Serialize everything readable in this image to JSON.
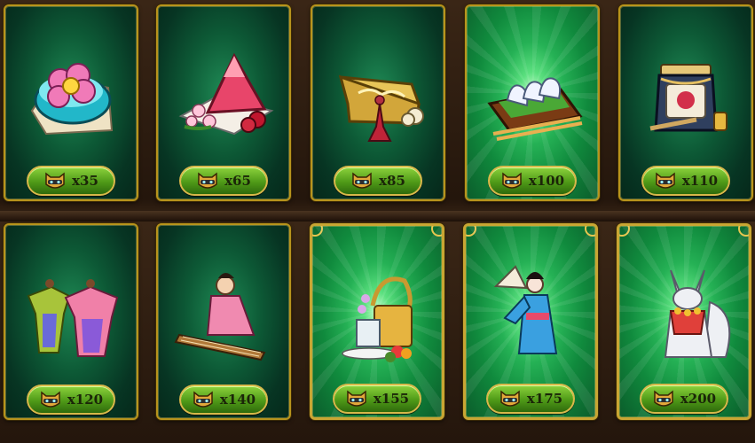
{
  "shop": {
    "currency_icon": "cat-mask-coin-icon",
    "items": [
      {
        "name": "Mochi Bowl",
        "icon": "flower-mochi-bowl-icon",
        "price": "x35"
      },
      {
        "name": "Sakura Cake",
        "icon": "sakura-cake-slice-icon",
        "price": "x65"
      },
      {
        "name": "Golden Purse",
        "icon": "golden-purse-tassel-icon",
        "price": "x85"
      },
      {
        "name": "Onigiri Plate",
        "icon": "onigiri-chopsticks-icon",
        "price": "x100"
      },
      {
        "name": "Sake Barrel",
        "icon": "sake-barrel-mallet-icon",
        "price": "x110"
      },
      {
        "name": "Kimono Mannequins",
        "icon": "kimono-mannequins-icon",
        "price": "x120"
      },
      {
        "name": "Koto Player",
        "icon": "koto-player-icon",
        "price": "x140"
      },
      {
        "name": "Picnic Basket",
        "icon": "bento-basket-icon",
        "price": "x155"
      },
      {
        "name": "Fan Dancer",
        "icon": "geisha-fan-dancer-icon",
        "price": "x175"
      },
      {
        "name": "Kitsune Statue",
        "icon": "kitsune-fox-icon",
        "price": "x200"
      }
    ]
  },
  "colors": {
    "frame_gold": "#b8941c",
    "price_green": "#6cb82a",
    "card_dark": "#0d5a36",
    "card_bright": "#25b155"
  }
}
